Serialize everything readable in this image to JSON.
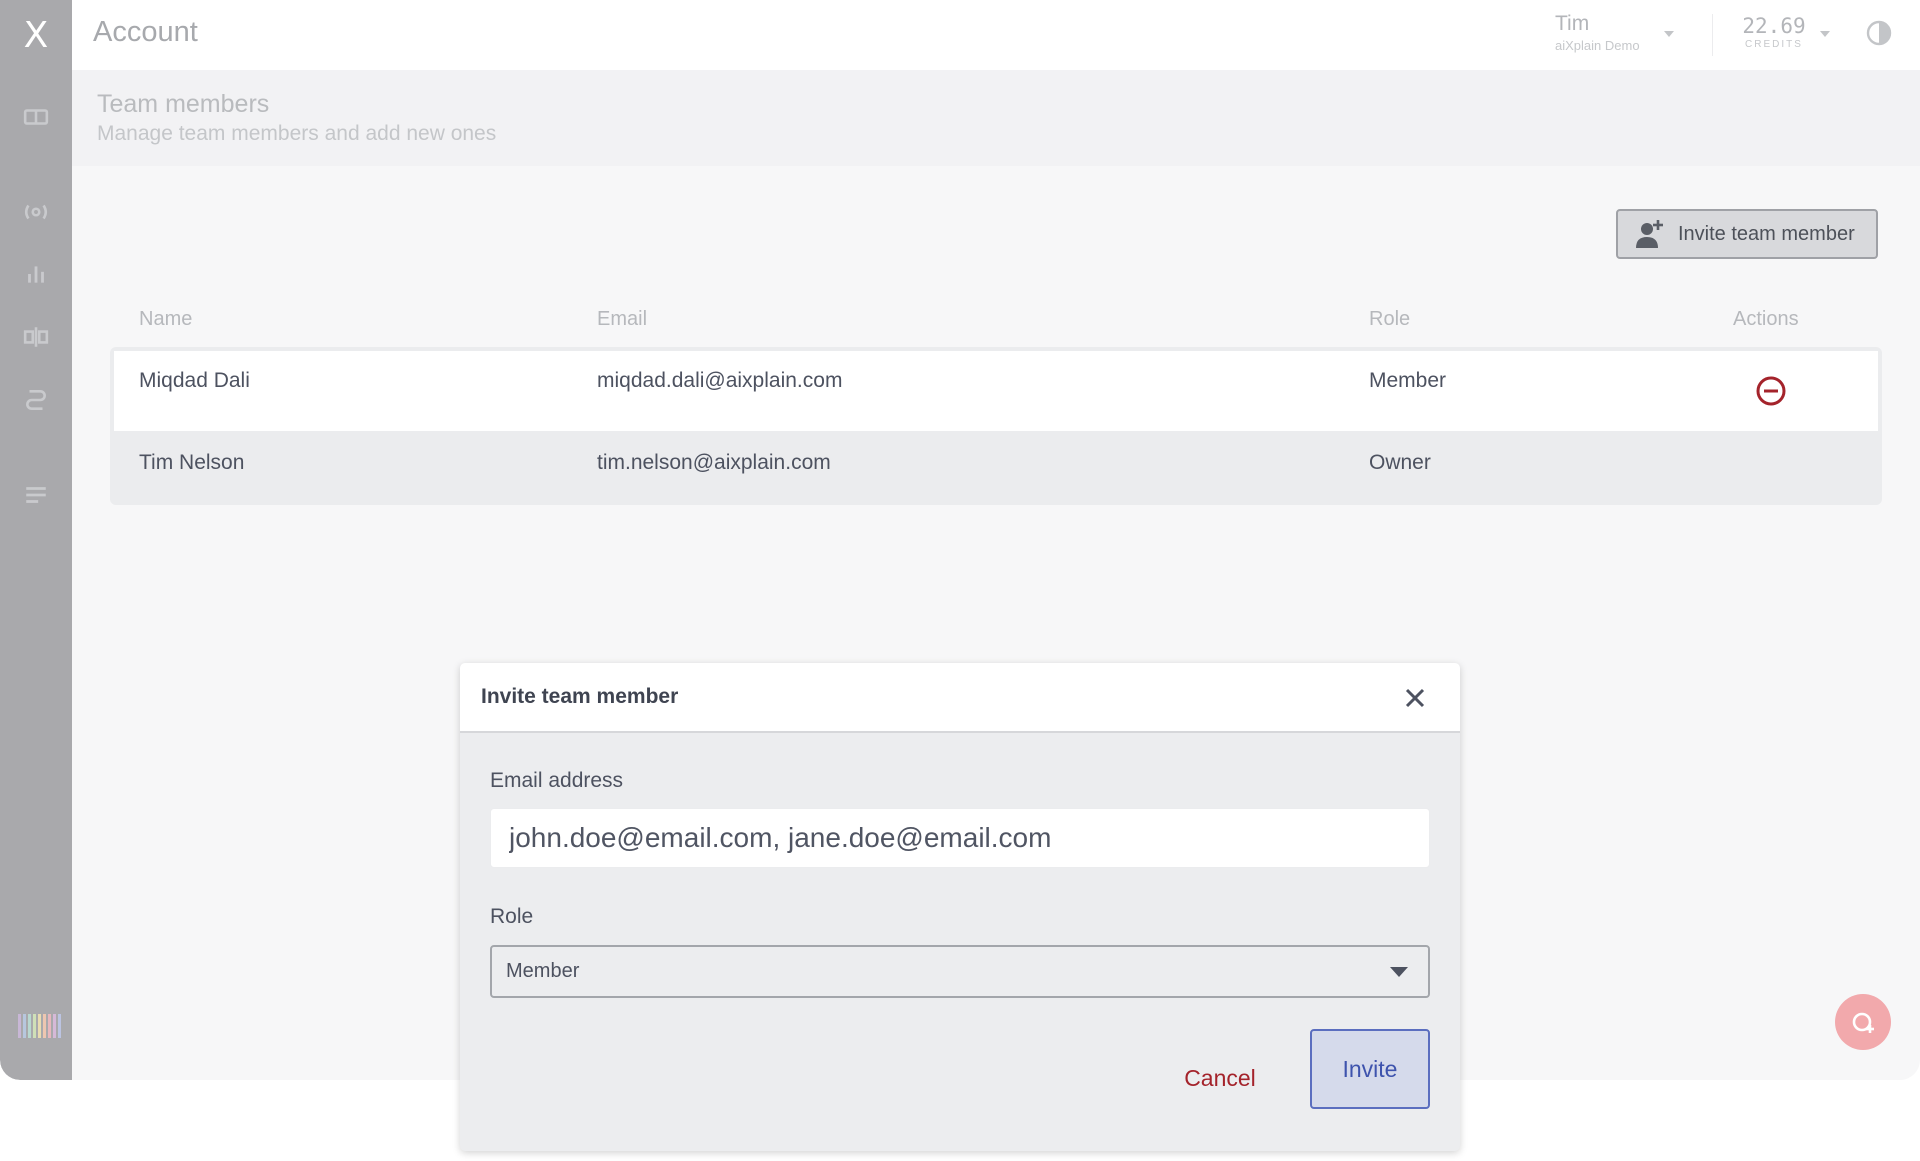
{
  "app": {
    "logo_glyph": "X",
    "page_title": "Account"
  },
  "sidebar": {
    "icons": [
      "dashboard-icon",
      "broadcast-icon",
      "bar-chart-icon",
      "swap-icon",
      "pipeline-icon",
      "list-icon"
    ]
  },
  "topbar": {
    "user_name": "Tim",
    "user_org": "aiXplain Demo",
    "credits_value": "22.69",
    "credits_label": "CREDITS"
  },
  "section": {
    "title": "Team members",
    "subtitle": "Manage team members and add new ones",
    "invite_button_label": "Invite team member"
  },
  "table": {
    "columns": {
      "name": "Name",
      "email": "Email",
      "role": "Role",
      "actions": "Actions"
    },
    "rows": [
      {
        "name": "Miqdad Dali",
        "email": "miqdad.dali@aixplain.com",
        "role": "Member"
      },
      {
        "name": "Tim Nelson",
        "email": "tim.nelson@aixplain.com",
        "role": "Owner"
      }
    ]
  },
  "modal": {
    "title": "Invite team member",
    "email_label": "Email address",
    "email_value": "john.doe@email.com, jane.doe@email.com",
    "role_label": "Role",
    "role_value": "Member",
    "cancel_label": "Cancel",
    "invite_label": "Invite"
  },
  "colors": {
    "danger": "#a4232b",
    "primary": "#3e53ad",
    "sidebar": "#a9a9ac"
  }
}
